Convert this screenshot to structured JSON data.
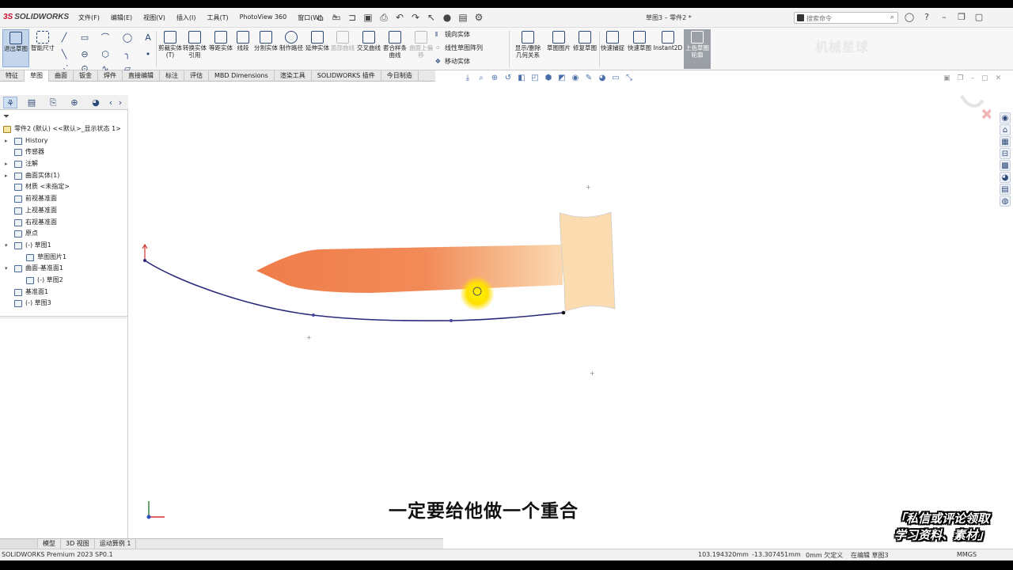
{
  "app": {
    "logo": "SOLIDWORKS",
    "document_title": "草图3 – 零件2 *",
    "status_version": "SOLIDWORKS Premium 2023 SP0.1"
  },
  "menu": [
    "文件(F)",
    "编辑(E)",
    "视图(V)",
    "插入(I)",
    "工具(T)",
    "PhotoView 360",
    "窗口(W)"
  ],
  "search": {
    "placeholder": "搜索命令"
  },
  "ribbon": {
    "exit_sketch": "退出草图",
    "smart_dim": "智能尺寸",
    "trim": "剪裁实体(T)",
    "convert": "转换实体引用",
    "offset": "等距实体",
    "line_seg": "线段",
    "split": "分割实体",
    "route": "制作路径",
    "extend": "延伸实体",
    "face_curve": "面部曲线",
    "intersect": "交叉曲线",
    "fit_spline": "套合样条曲线",
    "surface_offset": "曲面上偏移",
    "mirror": "镜向实体",
    "linear_pattern": "线性草图阵列",
    "move": "移动实体",
    "show_relations": "显示/删除几何关系",
    "sketch_picture": "草图图片",
    "repair": "修复草图",
    "quick_snap": "快速捕捉",
    "rapid_sketch": "快速草图",
    "instant2d": "Instant2D",
    "shaded_contours": "上色草图轮廓",
    "watermark": "机械星球"
  },
  "tabs": [
    "特征",
    "草图",
    "曲面",
    "钣金",
    "焊件",
    "直接编辑",
    "标注",
    "评估",
    "MBD Dimensions",
    "渲染工具",
    "SOLIDWORKS 插件",
    "今日制造"
  ],
  "active_tab": "草图",
  "tree": {
    "root": "零件2 (默认) <<默认>_显示状态 1>",
    "items": [
      {
        "label": "History",
        "indent": 0,
        "expand": "▸"
      },
      {
        "label": "传感器",
        "indent": 0,
        "expand": ""
      },
      {
        "label": "注解",
        "indent": 0,
        "expand": "▸"
      },
      {
        "label": "曲面实体(1)",
        "indent": 0,
        "expand": "▸"
      },
      {
        "label": "材质 <未指定>",
        "indent": 0,
        "expand": ""
      },
      {
        "label": "前视基准面",
        "indent": 0,
        "expand": ""
      },
      {
        "label": "上视基准面",
        "indent": 0,
        "expand": ""
      },
      {
        "label": "右视基准面",
        "indent": 0,
        "expand": ""
      },
      {
        "label": "原点",
        "indent": 0,
        "expand": ""
      },
      {
        "label": "(-) 草图1",
        "indent": 0,
        "expand": "▾"
      },
      {
        "label": "草图图片1",
        "indent": 1,
        "expand": ""
      },
      {
        "label": "曲面-基准面1",
        "indent": 0,
        "expand": "▾"
      },
      {
        "label": "(-) 草图2",
        "indent": 1,
        "expand": ""
      },
      {
        "label": "基准面1",
        "indent": 0,
        "expand": ""
      },
      {
        "label": "(-) 草图3",
        "indent": 0,
        "expand": ""
      }
    ]
  },
  "bottom_tabs": [
    "模型",
    "3D 视图",
    "运动算例 1"
  ],
  "status": {
    "x": "103.194320mm",
    "y": "-13.307451mm",
    "z": "0mm 欠定义",
    "editing": "在编辑 草图3",
    "units": "MMGS"
  },
  "subtitle": "一定要给他做一个重合",
  "promo": [
    "「私信或评论领取",
    "学习资料、素材」"
  ],
  "colors": {
    "blade_dark": "#ef7d4a",
    "blade_light": "#f8c9a0",
    "handle": "#fbdcb0",
    "spline": "#2b2a7a",
    "cursor_halo": "#ffe100"
  }
}
